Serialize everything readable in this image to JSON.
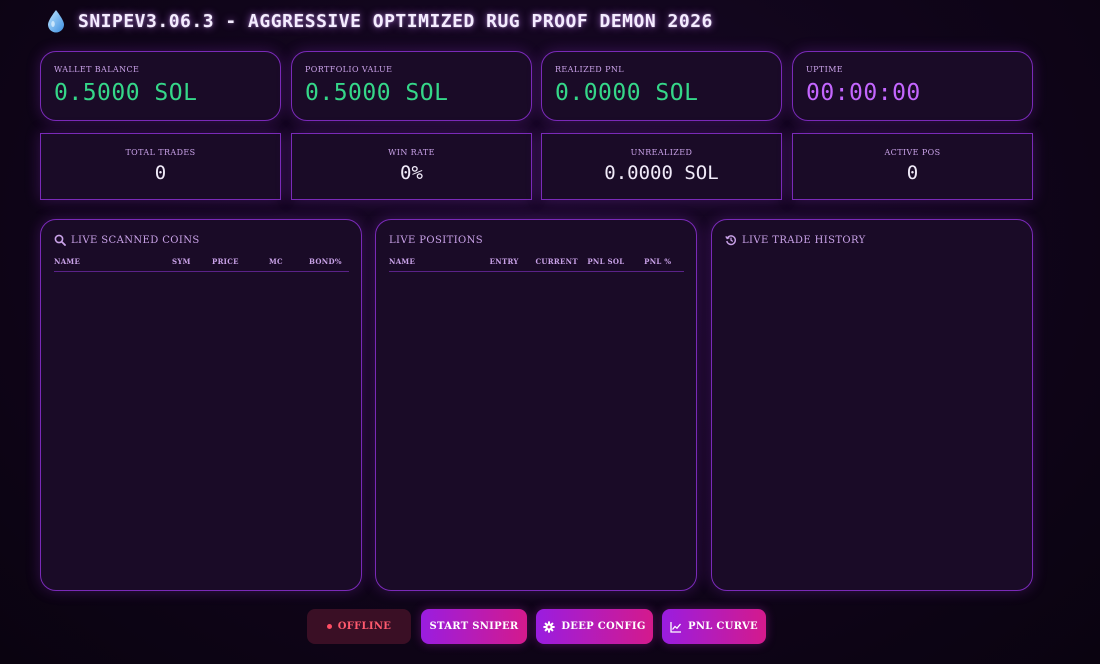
{
  "header": {
    "title": "SNIPEV3.06.3 - AGGRESSIVE OPTIMIZED RUG PROOF DEMON 2026",
    "icon": "water-drop-icon"
  },
  "stats_top": [
    {
      "label": "WALLET BALANCE",
      "value": "0.5000 SOL",
      "color": "#35d789"
    },
    {
      "label": "PORTFOLIO VALUE",
      "value": "0.5000 SOL",
      "color": "#35d789"
    },
    {
      "label": "REALIZED PNL",
      "value": "0.0000 SOL",
      "color": "#35d789"
    },
    {
      "label": "UPTIME",
      "value": "00:00:00",
      "color": "#c466ff"
    }
  ],
  "stats_bottom": [
    {
      "label": "TOTAL TRADES",
      "value": "0"
    },
    {
      "label": "WIN RATE",
      "value": "0%"
    },
    {
      "label": "UNREALIZED",
      "value": "0.0000 SOL"
    },
    {
      "label": "ACTIVE POS",
      "value": "0"
    }
  ],
  "panels": {
    "scanned": {
      "title": "LIVE SCANNED COINS",
      "icon": "search-icon",
      "columns": [
        "NAME",
        "SYM",
        "PRICE",
        "MC",
        "BOND%"
      ]
    },
    "positions": {
      "title": "LIVE POSITIONS",
      "columns": [
        "NAME",
        "ENTRY",
        "CURRENT",
        "PNL SOL",
        "PNL %"
      ]
    },
    "history": {
      "title": "LIVE TRADE HISTORY",
      "icon": "history-icon"
    }
  },
  "controls": {
    "status": "OFFLINE",
    "start": "START SNIPER",
    "config": "DEEP CONFIG",
    "pnl": "PNL CURVE"
  },
  "colors": {
    "accent": "#9a1de0",
    "accent_end": "#d41a8c",
    "positive": "#35d789",
    "uptime": "#c466ff",
    "offline": "#ff5a6e"
  }
}
